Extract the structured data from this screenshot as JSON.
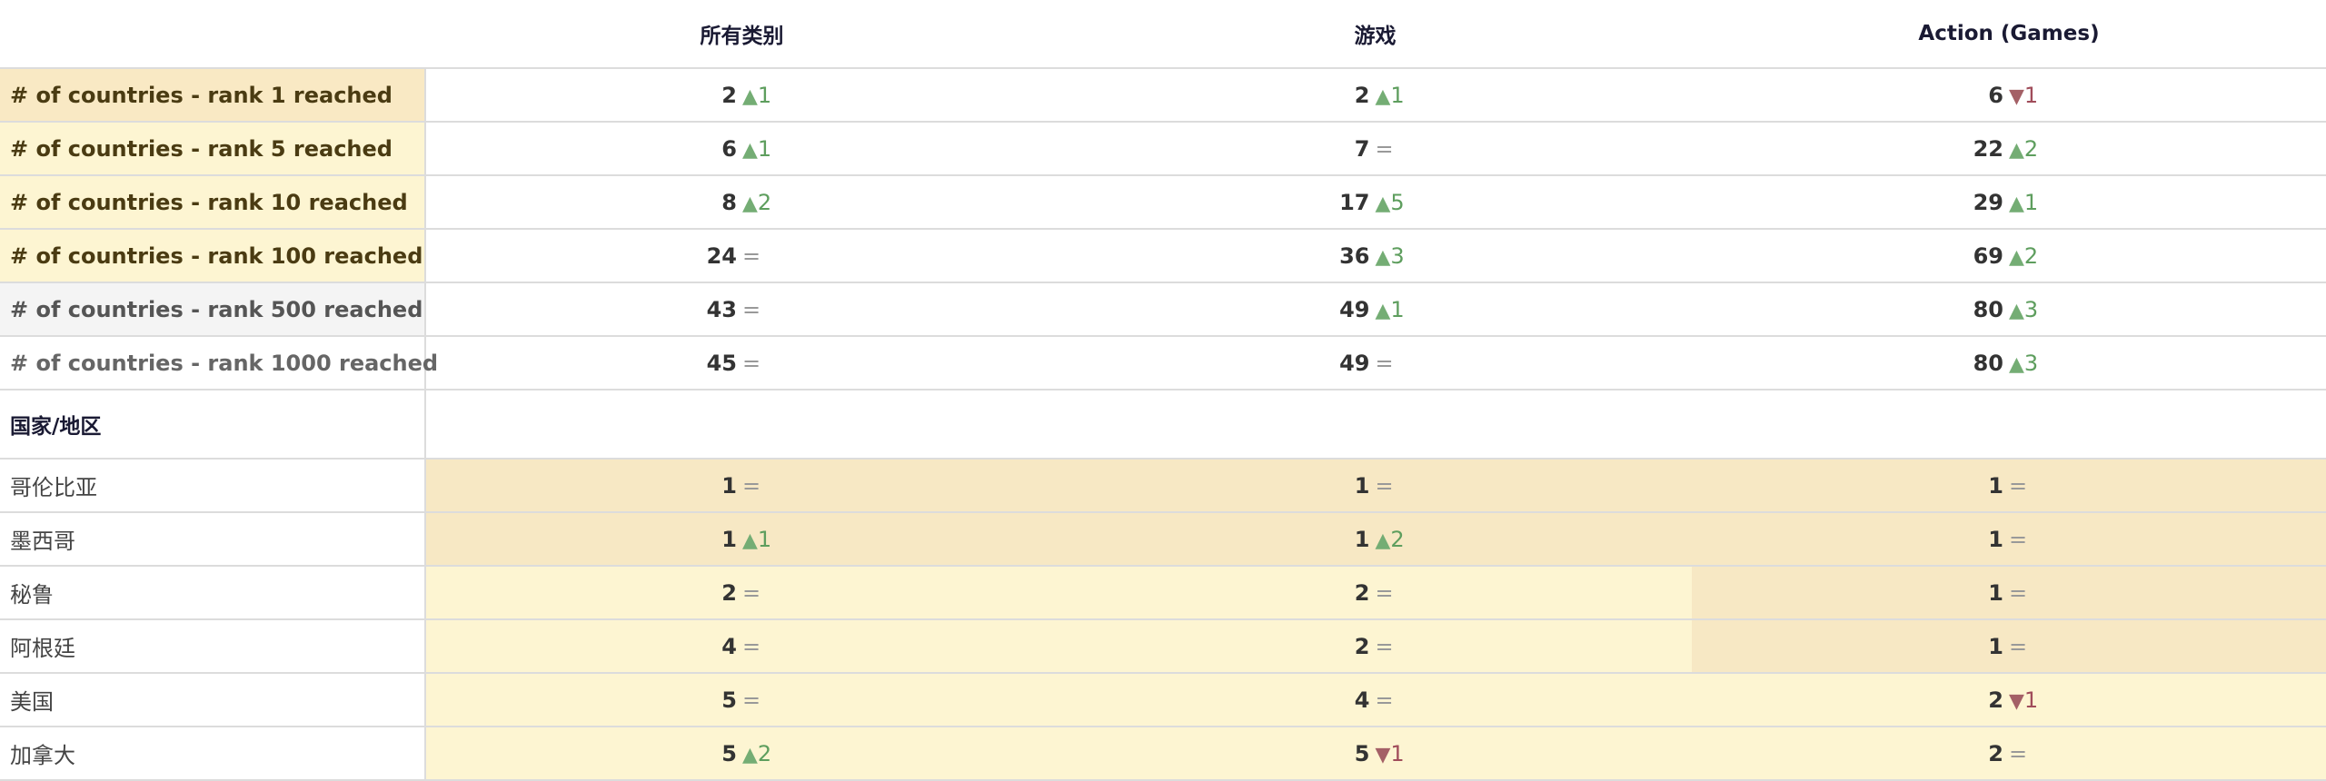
{
  "columns": [
    "所有类别",
    "游戏",
    "Action (Games)"
  ],
  "metrics": [
    {
      "label": "# of countries - rank 1 reached",
      "style": "gold",
      "cells": [
        {
          "value": "2",
          "dir": "up",
          "change": "1"
        },
        {
          "value": "2",
          "dir": "up",
          "change": "1"
        },
        {
          "value": "6",
          "dir": "down",
          "change": "1"
        }
      ]
    },
    {
      "label": "# of countries - rank 5 reached",
      "style": "cream",
      "cells": [
        {
          "value": "6",
          "dir": "up",
          "change": "1"
        },
        {
          "value": "7",
          "dir": "same",
          "change": "="
        },
        {
          "value": "22",
          "dir": "up",
          "change": "2"
        }
      ]
    },
    {
      "label": "# of countries - rank 10 reached",
      "style": "cream",
      "cells": [
        {
          "value": "8",
          "dir": "up",
          "change": "2"
        },
        {
          "value": "17",
          "dir": "up",
          "change": "5"
        },
        {
          "value": "29",
          "dir": "up",
          "change": "1"
        }
      ]
    },
    {
      "label": "# of countries - rank 100 reached",
      "style": "cream",
      "cells": [
        {
          "value": "24",
          "dir": "same",
          "change": "="
        },
        {
          "value": "36",
          "dir": "up",
          "change": "3"
        },
        {
          "value": "69",
          "dir": "up",
          "change": "2"
        }
      ]
    },
    {
      "label": "# of countries - rank 500 reached",
      "style": "grey",
      "cells": [
        {
          "value": "43",
          "dir": "same",
          "change": "="
        },
        {
          "value": "49",
          "dir": "up",
          "change": "1"
        },
        {
          "value": "80",
          "dir": "up",
          "change": "3"
        }
      ]
    },
    {
      "label": "# of countries - rank 1000 reached",
      "style": "white",
      "cells": [
        {
          "value": "45",
          "dir": "same",
          "change": "="
        },
        {
          "value": "49",
          "dir": "same",
          "change": "="
        },
        {
          "value": "80",
          "dir": "up",
          "change": "3"
        }
      ]
    }
  ],
  "countries_header": "国家/地区",
  "countries": [
    {
      "label": "哥伦比亚",
      "cells": [
        {
          "value": "1",
          "dir": "same",
          "change": "=",
          "bg": "gold"
        },
        {
          "value": "1",
          "dir": "same",
          "change": "=",
          "bg": "gold"
        },
        {
          "value": "1",
          "dir": "same",
          "change": "=",
          "bg": "gold"
        }
      ]
    },
    {
      "label": "墨西哥",
      "cells": [
        {
          "value": "1",
          "dir": "up",
          "change": "1",
          "bg": "gold"
        },
        {
          "value": "1",
          "dir": "up",
          "change": "2",
          "bg": "gold"
        },
        {
          "value": "1",
          "dir": "same",
          "change": "=",
          "bg": "gold"
        }
      ]
    },
    {
      "label": "秘鲁",
      "cells": [
        {
          "value": "2",
          "dir": "same",
          "change": "=",
          "bg": "cream"
        },
        {
          "value": "2",
          "dir": "same",
          "change": "=",
          "bg": "cream"
        },
        {
          "value": "1",
          "dir": "same",
          "change": "=",
          "bg": "gold"
        }
      ]
    },
    {
      "label": "阿根廷",
      "cells": [
        {
          "value": "4",
          "dir": "same",
          "change": "=",
          "bg": "cream"
        },
        {
          "value": "2",
          "dir": "same",
          "change": "=",
          "bg": "cream"
        },
        {
          "value": "1",
          "dir": "same",
          "change": "=",
          "bg": "gold"
        }
      ]
    },
    {
      "label": "美国",
      "cells": [
        {
          "value": "5",
          "dir": "same",
          "change": "=",
          "bg": "cream"
        },
        {
          "value": "4",
          "dir": "same",
          "change": "=",
          "bg": "cream"
        },
        {
          "value": "2",
          "dir": "down",
          "change": "1",
          "bg": "cream"
        }
      ]
    },
    {
      "label": "加拿大",
      "cells": [
        {
          "value": "5",
          "dir": "up",
          "change": "2",
          "bg": "cream"
        },
        {
          "value": "5",
          "dir": "down",
          "change": "1",
          "bg": "cream"
        },
        {
          "value": "2",
          "dir": "same",
          "change": "=",
          "bg": "cream"
        }
      ]
    }
  ],
  "colors": {
    "up": "#5e9e5e",
    "down": "#a04c5a",
    "gold": "#f7e8c4",
    "cream": "#fdf5d2"
  },
  "icons": {
    "up": "triangle-up-icon",
    "down": "triangle-down-icon"
  }
}
